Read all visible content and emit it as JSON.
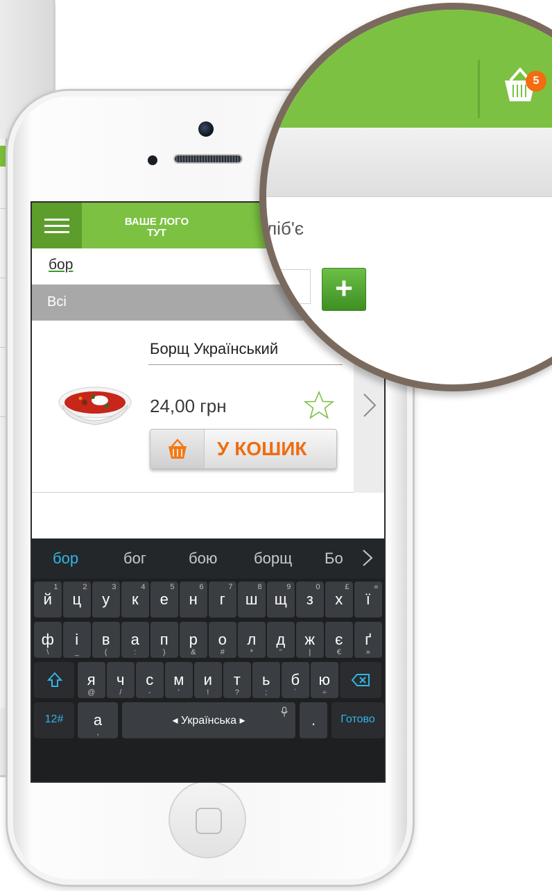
{
  "header": {
    "logo_line1": "ВАШЕ ЛОГО",
    "logo_line2": "ТУТ"
  },
  "search": {
    "query": "бор"
  },
  "category": {
    "label": "Всі"
  },
  "product": {
    "name": "Борщ Український",
    "price": "24,00 грн",
    "add_to_cart_label": "У КОШИК",
    "favorite_icon": "star-outline-icon",
    "next_icon": "chevron-right-icon"
  },
  "magnifier": {
    "cart_count": "5",
    "partial_text": "ліб'є",
    "plus_label": "+"
  },
  "keyboard": {
    "suggestions": [
      "бор",
      "бог",
      "бою",
      "борщ",
      "Бо"
    ],
    "row1": [
      {
        "k": "й",
        "n": "1"
      },
      {
        "k": "ц",
        "n": "2"
      },
      {
        "k": "у",
        "n": "3"
      },
      {
        "k": "к",
        "n": "4"
      },
      {
        "k": "е",
        "n": "5"
      },
      {
        "k": "н",
        "n": "6"
      },
      {
        "k": "г",
        "n": "7"
      },
      {
        "k": "ш",
        "n": "8"
      },
      {
        "k": "щ",
        "n": "9"
      },
      {
        "k": "з",
        "n": "0"
      },
      {
        "k": "х",
        "n": "£"
      },
      {
        "k": "ї",
        "n": "«"
      }
    ],
    "row2": [
      {
        "k": "ф",
        "s": "\\"
      },
      {
        "k": "і",
        "s": "_"
      },
      {
        "k": "в",
        "s": "("
      },
      {
        "k": "а",
        "s": ":"
      },
      {
        "k": "п",
        "s": ")"
      },
      {
        "k": "р",
        "s": "&"
      },
      {
        "k": "о",
        "s": "#"
      },
      {
        "k": "л",
        "s": "*"
      },
      {
        "k": "д",
        "s": "\""
      },
      {
        "k": "ж",
        "s": "|"
      },
      {
        "k": "є",
        "s": "€"
      },
      {
        "k": "ґ",
        "s": "»"
      }
    ],
    "row3": [
      {
        "k": "я",
        "s": "@"
      },
      {
        "k": "ч",
        "s": "/"
      },
      {
        "k": "с",
        "s": "-"
      },
      {
        "k": "м",
        "s": "'"
      },
      {
        "k": "и",
        "s": "!"
      },
      {
        "k": "т",
        "s": "?"
      },
      {
        "k": "ь",
        "s": ";"
      },
      {
        "k": "б",
        "s": "`"
      },
      {
        "k": "ю",
        "s": "÷"
      }
    ],
    "numbers_key": "12#",
    "lang_key": "а",
    "lang_key_sub": ",",
    "space_label": "◂ Українська ▸",
    "period_key": ".",
    "done_key": "Готово",
    "accent_color": "#33b5e5"
  },
  "colors": {
    "brand_green": "#7cc142",
    "brand_green_dark": "#5d9d2c",
    "cart_orange": "#ef6c0f",
    "category_gray": "#a8a8a8"
  }
}
